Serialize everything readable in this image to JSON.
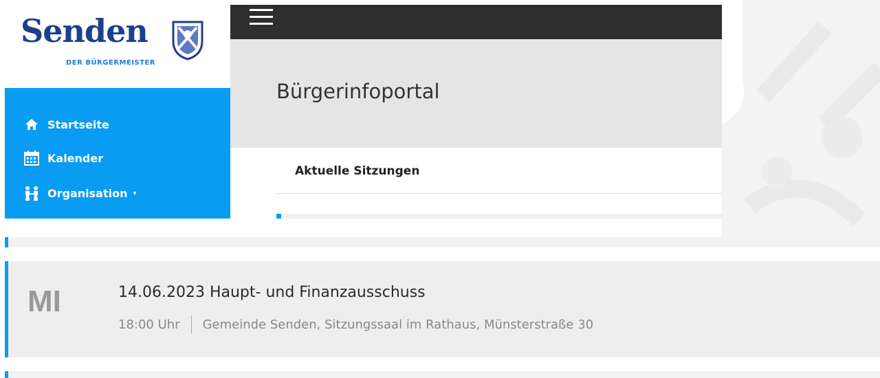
{
  "logo": {
    "wordmark": "Senden",
    "subtitle": "DER BÜRGERMEISTER"
  },
  "nav": {
    "items": [
      {
        "label": "Startseite",
        "icon": "home-icon"
      },
      {
        "label": "Kalender",
        "icon": "calendar-icon"
      },
      {
        "label": "Organisation",
        "icon": "organisation-icon",
        "caret": "▾"
      }
    ]
  },
  "header": {
    "title": "Bürgerinfoportal"
  },
  "card": {
    "title": "Aktuelle Sitzungen"
  },
  "events": [
    {
      "day": "MI",
      "title": "14.06.2023 Haupt- und Finanzausschuss",
      "time": "18:00 Uhr",
      "location": "Gemeinde Senden, Sitzungssaal im Rathaus, Münsterstraße 30"
    }
  ],
  "colors": {
    "accent": "#0a9cf2",
    "topbar": "#2e2e2e",
    "brand": "#1d3f8c"
  }
}
